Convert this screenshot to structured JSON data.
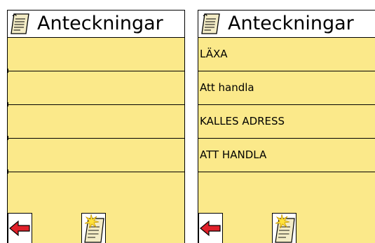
{
  "app": {
    "title": "Anteckningar",
    "icon": "note-icon"
  },
  "screens": [
    {
      "id": "empty-list",
      "notes": []
    },
    {
      "id": "note-list",
      "notes": [
        {
          "title": "LÄXA"
        },
        {
          "title": "Att handla"
        },
        {
          "title": "KALLES ADRESS"
        },
        {
          "title": "ATT HANDLA"
        }
      ]
    }
  ],
  "toolbar": {
    "back_icon": "back-arrow-icon",
    "new_icon": "new-note-icon"
  },
  "colors": {
    "list_background": "#fbe98a",
    "header_background": "#ffffff",
    "arrow": "#e0202a"
  }
}
